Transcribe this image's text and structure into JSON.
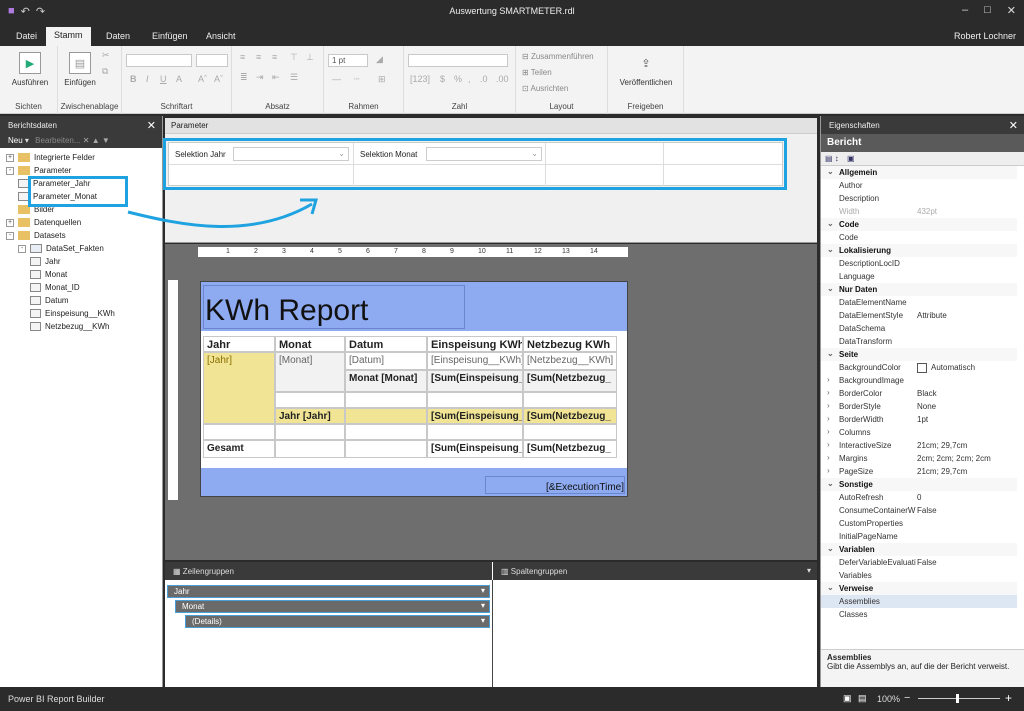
{
  "window": {
    "title": "Auswertung SMARTMETER.rdl",
    "user": "Robert Lochner"
  },
  "tabs": [
    "Datei",
    "Stamm",
    "Daten",
    "Einfügen",
    "Ansicht"
  ],
  "ribbon": {
    "groups": {
      "sichten": "Sichten",
      "zwischenablage": "Zwischenablage",
      "schriftart": "Schriftart",
      "absatz": "Absatz",
      "rahmen": "Rahmen",
      "zahl": "Zahl",
      "layout": "Layout",
      "freigeben": "Freigeben"
    },
    "ausfuehren": "Ausführen",
    "einfuegen": "Einfügen",
    "border_width": "1 pt",
    "zusammenfuehren": "Zusammenführen",
    "teilen": "Teilen",
    "ausrichten": "Ausrichten",
    "veroeffentlichen": "Veröffentlichen"
  },
  "report_data": {
    "header": "Berichtsdaten",
    "toolbar_new": "Neu",
    "toolbar_edit": "Bearbeiten...",
    "tree": [
      {
        "label": "Integrierte Felder",
        "level": 0,
        "kind": "folder",
        "toggle": "+"
      },
      {
        "label": "Parameter",
        "level": 0,
        "kind": "folder",
        "toggle": "-"
      },
      {
        "label": "Parameter_Jahr",
        "level": 1,
        "kind": "param"
      },
      {
        "label": "Parameter_Monat",
        "level": 1,
        "kind": "param"
      },
      {
        "label": "Bilder",
        "level": 0,
        "kind": "folder",
        "toggle": ""
      },
      {
        "label": "Datenquellen",
        "level": 0,
        "kind": "folder",
        "toggle": "+"
      },
      {
        "label": "Datasets",
        "level": 0,
        "kind": "folder",
        "toggle": "-"
      },
      {
        "label": "DataSet_Fakten",
        "level": 1,
        "kind": "table",
        "toggle": "-"
      },
      {
        "label": "Jahr",
        "level": 2,
        "kind": "field"
      },
      {
        "label": "Monat",
        "level": 2,
        "kind": "field"
      },
      {
        "label": "Monat_ID",
        "level": 2,
        "kind": "field"
      },
      {
        "label": "Datum",
        "level": 2,
        "kind": "field"
      },
      {
        "label": "Einspeisung__KWh",
        "level": 2,
        "kind": "field"
      },
      {
        "label": "Netzbezug__KWh",
        "level": 2,
        "kind": "field"
      }
    ]
  },
  "parameter_panel": {
    "header": "Parameter",
    "param1": "Selektion Jahr",
    "param2": "Selektion Monat"
  },
  "ruler_ticks": [
    "1",
    "2",
    "3",
    "4",
    "5",
    "6",
    "7",
    "8",
    "9",
    "10",
    "11",
    "12",
    "13",
    "14"
  ],
  "report": {
    "title": "KWh Report",
    "columns": [
      "Jahr",
      "Monat",
      "Datum",
      "Einspeisung KWh",
      "Netzbezug KWh"
    ],
    "row1": [
      "[Jahr]",
      "[Monat]",
      "[Datum]",
      "[Einspeisung__KWh]",
      "[Netzbezug__KWh]"
    ],
    "row2": [
      "Monat [Monat]",
      "[Sum(Einspeisung_",
      "[Sum(Netzbezug_"
    ],
    "row3": [
      "Jahr [Jahr]",
      "[Sum(Einspeisung_",
      "[Sum(Netzbezug_"
    ],
    "total": [
      "Gesamt",
      "[Sum(Einspeisung_",
      "[Sum(Netzbezug_"
    ],
    "footer": "[&ExecutionTime]"
  },
  "groups": {
    "row_header": "Zeilengruppen",
    "col_header": "Spaltengruppen",
    "rows": [
      "Jahr",
      "Monat",
      "(Details)"
    ]
  },
  "properties": {
    "header": "Eigenschaften",
    "object": "Bericht",
    "rows": [
      {
        "name": "Allgemein",
        "cat": true
      },
      {
        "name": "Author",
        "value": ""
      },
      {
        "name": "Description",
        "value": ""
      },
      {
        "name": "Width",
        "value": "432pt",
        "disabled": true
      },
      {
        "name": "Code",
        "cat": true
      },
      {
        "name": "Code",
        "value": ""
      },
      {
        "name": "Lokalisierung",
        "cat": true
      },
      {
        "name": "DescriptionLocID",
        "value": ""
      },
      {
        "name": "Language",
        "value": ""
      },
      {
        "name": "Nur Daten",
        "cat": true
      },
      {
        "name": "DataElementName",
        "value": ""
      },
      {
        "name": "DataElementStyle",
        "value": "Attribute"
      },
      {
        "name": "DataSchema",
        "value": ""
      },
      {
        "name": "DataTransform",
        "value": ""
      },
      {
        "name": "Seite",
        "cat": true
      },
      {
        "name": "BackgroundColor",
        "value": "Automatisch",
        "swatch": true
      },
      {
        "name": "BackgroundImage",
        "value": "",
        "expand": true
      },
      {
        "name": "BorderColor",
        "value": "Black",
        "expand": true
      },
      {
        "name": "BorderStyle",
        "value": "None",
        "expand": true
      },
      {
        "name": "BorderWidth",
        "value": "1pt",
        "expand": true
      },
      {
        "name": "Columns",
        "value": "",
        "expand": true
      },
      {
        "name": "InteractiveSize",
        "value": "21cm; 29,7cm",
        "expand": true
      },
      {
        "name": "Margins",
        "value": "2cm; 2cm; 2cm; 2cm",
        "expand": true
      },
      {
        "name": "PageSize",
        "value": "21cm; 29,7cm",
        "expand": true
      },
      {
        "name": "Sonstige",
        "cat": true
      },
      {
        "name": "AutoRefresh",
        "value": "0"
      },
      {
        "name": "ConsumeContainerW",
        "value": "False"
      },
      {
        "name": "CustomProperties",
        "value": ""
      },
      {
        "name": "InitialPageName",
        "value": ""
      },
      {
        "name": "Variablen",
        "cat": true
      },
      {
        "name": "DeferVariableEvaluati",
        "value": "False"
      },
      {
        "name": "Variables",
        "value": ""
      },
      {
        "name": "Verweise",
        "cat": true
      },
      {
        "name": "Assemblies",
        "value": "",
        "selected": true
      },
      {
        "name": "Classes",
        "value": ""
      }
    ],
    "desc_title": "Assemblies",
    "desc_text": "Gibt die Assemblys an, auf die der Bericht verweist."
  },
  "status": {
    "app": "Power BI Report Builder",
    "zoom": "100%"
  },
  "colors": {
    "accent": "#1fa3e0",
    "report_band": "#8eaaf0",
    "group_band": "#f1e595"
  }
}
